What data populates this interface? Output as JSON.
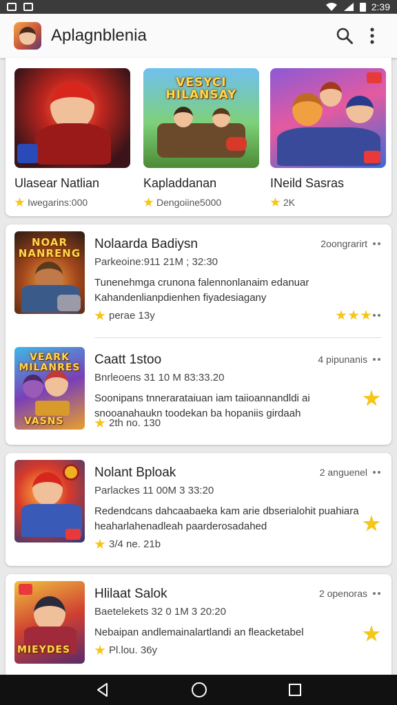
{
  "status_bar": {
    "time": "2:39"
  },
  "app_bar": {
    "title": "Aplagnblenia",
    "search_icon": "search-icon",
    "menu_icon": "more-vert-icon"
  },
  "featured": [
    {
      "name": "Ulasear Natlian",
      "meta": "Iwegarins:000",
      "badge_color": "#f5c518"
    },
    {
      "name": "Kapladdanan",
      "meta": "Dengoiine5000",
      "badge_color": "#f5c518"
    },
    {
      "name": "INeild Sasras",
      "meta": "2K",
      "badge_color": "#f5c518"
    }
  ],
  "thumb_text": {
    "f2_banner": "VESYCI HILANSAY",
    "l1_banner": "NOAR NANRENG",
    "l2_banner": "VEARK MILANRES",
    "l2_banner_bottom": "VASNS",
    "l4_banner": "MIEYDES"
  },
  "list": [
    {
      "title": "Nolaarda Badiysn",
      "right_meta": "2oongrarirt",
      "sub": "Parkeoine:911 21M ; 32:30",
      "desc": "Tunenehmga crunona falennonlanaim edanuar Kahandenlianpdienhen fiyadesiagany",
      "rating": "perae 13y",
      "stars": 3
    },
    {
      "title": "Caatt 1stoo",
      "right_meta": "4 pipunanis",
      "sub": "Bnrleoens 31 10 M 83:33.20",
      "desc": "Soonipans tnnerarataiuan iam taiioannandldi ai snooanahaukn toodekan ba hopaniis girdaah",
      "rating": "2th no. 130",
      "stars": 1
    },
    {
      "title": "Nolant Bploak",
      "right_meta": "2 anguenel",
      "sub": "Parlackes 11 00M 3 33:20",
      "desc": "Redendcans dahcaabaeka kam arie dbserialohit puahiara heaharlahenadleah paarderosadahed",
      "rating": "3/4 ne. 21b",
      "stars": 1
    },
    {
      "title": "Hlilaat Salok",
      "right_meta": "2 openoras",
      "sub": "Baetelekets 32 0 1M 3 20:20",
      "desc": "Nebaipan andlemainalartlandi an fleacketabel",
      "rating": "Pl.lou. 36y",
      "stars": 1
    }
  ],
  "nav": {
    "back_icon": "back-icon",
    "home_icon": "home-icon",
    "recents_icon": "recents-icon"
  }
}
